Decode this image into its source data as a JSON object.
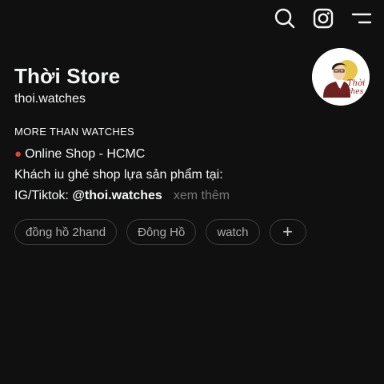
{
  "profile": {
    "name": "Thời Store",
    "handle": "thoi.watches",
    "avatar_text": [
      "Thời",
      "Watches"
    ]
  },
  "bio": {
    "line1": "MORE THAN WATCHES",
    "line2": "Online Shop - HCMC",
    "line3": "Khách iu ghé shop lựa sản phẩm tại:",
    "line4_prefix": "IG/Tiktok:",
    "line4_mention": "@thoi.watches",
    "more_label": "xem thêm"
  },
  "tags": [
    "đồng hồ 2hand",
    "Đông Hồ",
    "watch"
  ],
  "add_label": "+",
  "icons": {
    "search": "search-icon",
    "instagram": "instagram-icon",
    "menu": "menu-icon",
    "pin": "pin-icon"
  },
  "colors": {
    "background": "#101010",
    "text": "#f3f5f7",
    "muted": "#777777",
    "chip_border": "#3b3b3b",
    "avatar_text": "#8b1a1a"
  }
}
